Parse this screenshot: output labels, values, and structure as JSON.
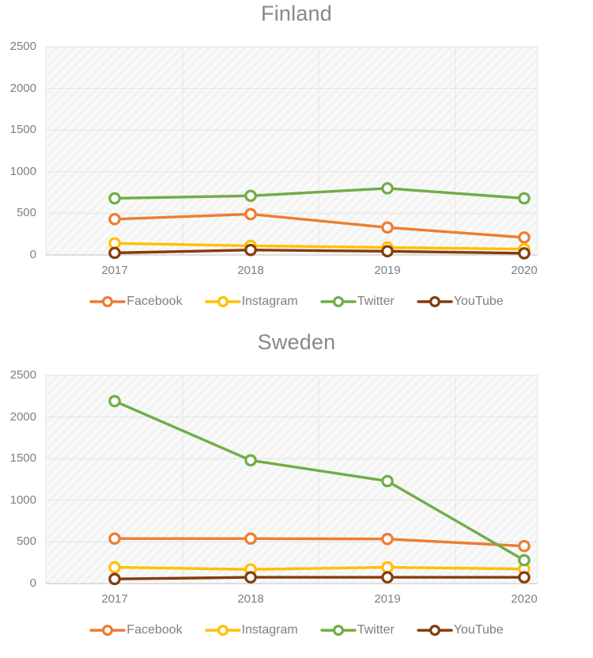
{
  "charts": [
    {
      "title": "Finland",
      "categories": [
        "2017",
        "2018",
        "2019",
        "2020"
      ],
      "yticks": [
        "0",
        "500",
        "1000",
        "1500",
        "2000",
        "2500"
      ],
      "legend": [
        "Facebook",
        "Instagram",
        "Twitter",
        "YouTube"
      ]
    },
    {
      "title": "Sweden",
      "categories": [
        "2017",
        "2018",
        "2019",
        "2020"
      ],
      "yticks": [
        "0",
        "500",
        "1000",
        "1500",
        "2000",
        "2500"
      ],
      "legend": [
        "Facebook",
        "Instagram",
        "Twitter",
        "YouTube"
      ]
    }
  ],
  "colors": {
    "facebook": "#ED7D31",
    "instagram": "#FFC000",
    "twitter": "#70AD47",
    "youtube": "#843C0C",
    "axis_text": "#7f7f7f",
    "title_text": "#888888",
    "plot_background": "#f2f2f2",
    "gridline": "#e4e4e4"
  },
  "chart_data": [
    {
      "type": "line",
      "title": "Finland",
      "xlabel": "",
      "ylabel": "",
      "categories": [
        "2017",
        "2018",
        "2019",
        "2020"
      ],
      "ylim": [
        0,
        2500
      ],
      "yticks": [
        0,
        500,
        1000,
        1500,
        2000,
        2500
      ],
      "grid": true,
      "legend_position": "bottom",
      "series": [
        {
          "name": "Facebook",
          "color": "#ED7D31",
          "values": [
            430,
            490,
            330,
            210
          ]
        },
        {
          "name": "Instagram",
          "color": "#FFC000",
          "values": [
            140,
            110,
            90,
            70
          ]
        },
        {
          "name": "Twitter",
          "color": "#70AD47",
          "values": [
            680,
            710,
            800,
            680
          ]
        },
        {
          "name": "YouTube",
          "color": "#843C0C",
          "values": [
            25,
            60,
            45,
            20
          ]
        }
      ]
    },
    {
      "type": "line",
      "title": "Sweden",
      "xlabel": "",
      "ylabel": "",
      "categories": [
        "2017",
        "2018",
        "2019",
        "2020"
      ],
      "ylim": [
        0,
        2500
      ],
      "yticks": [
        0,
        500,
        1000,
        1500,
        2000,
        2500
      ],
      "grid": true,
      "legend_position": "bottom",
      "series": [
        {
          "name": "Facebook",
          "color": "#ED7D31",
          "values": [
            540,
            540,
            535,
            450
          ]
        },
        {
          "name": "Instagram",
          "color": "#FFC000",
          "values": [
            195,
            170,
            195,
            175
          ]
        },
        {
          "name": "Twitter",
          "color": "#70AD47",
          "values": [
            2190,
            1480,
            1230,
            280
          ]
        },
        {
          "name": "YouTube",
          "color": "#843C0C",
          "values": [
            55,
            75,
            75,
            75
          ]
        }
      ]
    }
  ]
}
